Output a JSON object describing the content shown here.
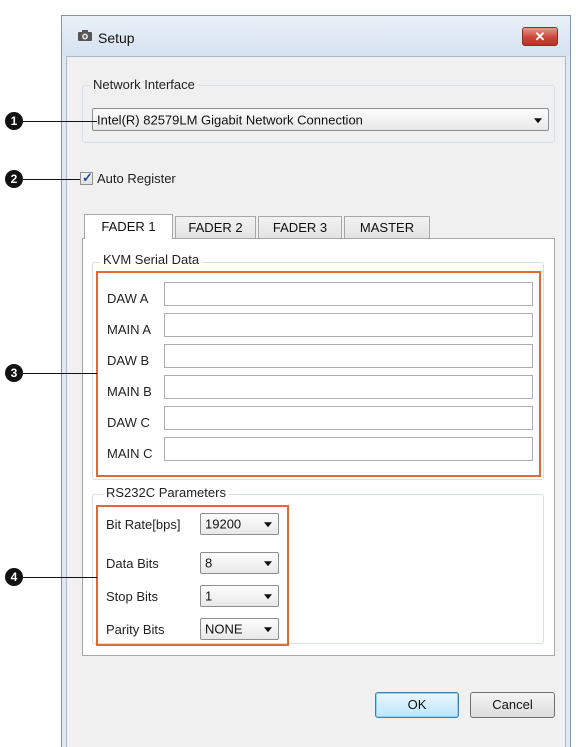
{
  "window": {
    "title": "Setup",
    "close_symbol": "✕"
  },
  "network": {
    "group_label": "Network Interface",
    "selected": "Intel(R) 82579LM Gigabit Network Connection"
  },
  "auto_register": {
    "label": "Auto Register",
    "checked": true,
    "check_mark": "✓"
  },
  "tabs": [
    {
      "label": "FADER 1",
      "active": true
    },
    {
      "label": "FADER 2",
      "active": false
    },
    {
      "label": "FADER 3",
      "active": false
    },
    {
      "label": "MASTER",
      "active": false
    }
  ],
  "kvm": {
    "group_label": "KVM Serial Data",
    "rows": [
      {
        "label": "DAW A",
        "value": ""
      },
      {
        "label": "MAIN A",
        "value": ""
      },
      {
        "label": "DAW B",
        "value": ""
      },
      {
        "label": "MAIN B",
        "value": ""
      },
      {
        "label": "DAW C",
        "value": ""
      },
      {
        "label": "MAIN C",
        "value": ""
      }
    ]
  },
  "rs232c": {
    "group_label": "RS232C Parameters",
    "rows": [
      {
        "label": "Bit Rate[bps]",
        "value": "19200"
      },
      {
        "label": "Data Bits",
        "value": "8"
      },
      {
        "label": "Stop Bits",
        "value": "1"
      },
      {
        "label": "Parity Bits",
        "value": "NONE"
      }
    ]
  },
  "buttons": {
    "ok": "OK",
    "cancel": "Cancel"
  },
  "callouts": [
    "1",
    "2",
    "3",
    "4"
  ],
  "colors": {
    "highlight": "#e06a36",
    "close_button": "#c9473a",
    "default_button": "#3c7fb1"
  }
}
